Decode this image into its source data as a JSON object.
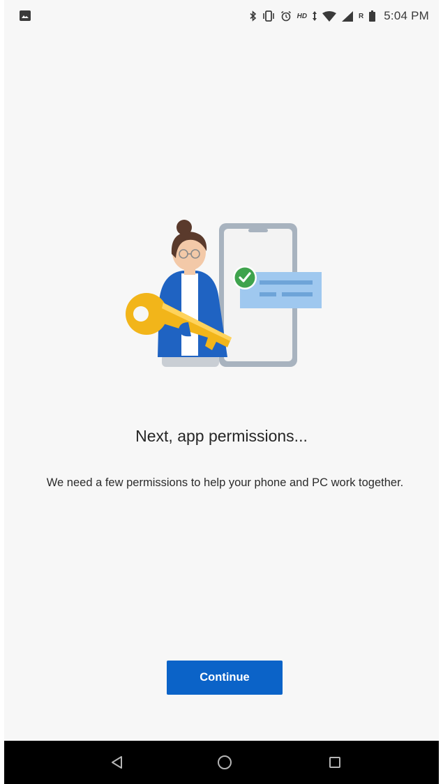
{
  "status_bar": {
    "time": "5:04 PM",
    "hd_label": "HD",
    "roaming_label": "R",
    "left_icon": "image-notification-icon",
    "right_icons": [
      "bluetooth-icon",
      "vibrate-icon",
      "alarm-icon",
      "hd-voice-icon",
      "data-arrows-icon",
      "wifi-icon",
      "cell-signal-icon",
      "roaming-icon",
      "battery-icon"
    ]
  },
  "main": {
    "title": "Next, app permissions...",
    "description": "We need a few permissions to help your phone and PC work together.",
    "continue_label": "Continue",
    "illustration": "person-holding-key-phone-checkmark-illustration"
  },
  "nav_bar": {
    "buttons": [
      "back-icon",
      "home-icon",
      "recents-icon"
    ]
  },
  "colors": {
    "accent": "#0b63c8",
    "background": "#f7f7f7",
    "nav_bar": "#000000",
    "check_green": "#3fa34d",
    "key_yellow": "#f2b51a",
    "jacket_blue": "#1f63c2"
  }
}
